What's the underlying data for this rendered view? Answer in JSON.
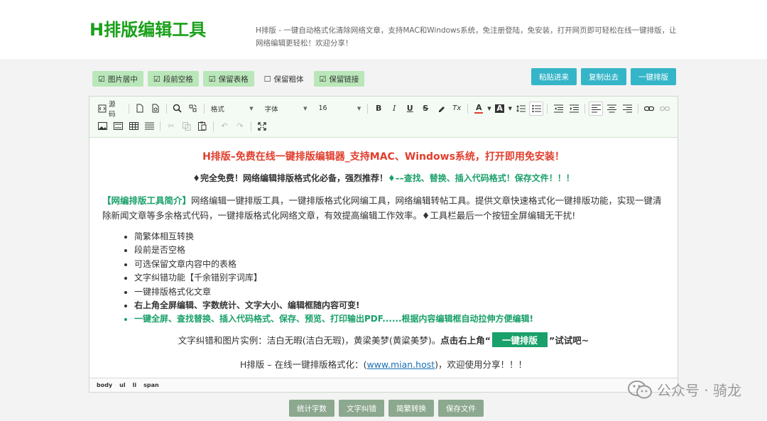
{
  "header": {
    "logo": "H排版编辑工具",
    "description": "H排版 - 一键自动格式化清除网络文章，支持MAC和Windows系统，免注册登陆，免安装，打开网页即可轻松在线一键排版，让网络编辑更轻松！欢迎分享！"
  },
  "options": [
    {
      "label": "图片居中",
      "checked": true,
      "mark": "☑"
    },
    {
      "label": "段前空格",
      "checked": true,
      "mark": "☑"
    },
    {
      "label": "保留表格",
      "checked": true,
      "mark": "☑"
    },
    {
      "label": "保留粗体",
      "checked": false,
      "mark": "☐"
    },
    {
      "label": "保留链接",
      "checked": true,
      "mark": "☑"
    }
  ],
  "actions": {
    "paste": "粘贴进来",
    "copy": "复制出去",
    "format": "一键排版"
  },
  "toolbar": {
    "source": "源码",
    "format_select": "格式",
    "font_select": "字体",
    "size_select": "16",
    "bold": "B",
    "italic": "I",
    "underline": "U",
    "strike": "S",
    "clear": "Tx",
    "font_color": "A",
    "bg_color": "A"
  },
  "content": {
    "title": "H排版–免费在线一键排版编辑器_支持MAC、Windows系统，打开即用免安装！",
    "subtitle_a": "♦完全免费！网络编辑排版格式化必备，强烈推荐！",
    "subtitle_b": "♦––查找、替换、插入代码格式！保存文件！！！",
    "intro_lead": "【网编排版工具简介】",
    "intro_text": "网络编辑一键排版工具，一键排版格式化网编工具，网络编辑转帖工具。提供文章快速格式化一键排版功能，实现一键清除新闻文章等多余格式代码，一键排版格式化网络文章，有效提高编辑工作效率。♦工具栏最后一个按钮全屏编辑无干扰!",
    "features": [
      "简繁体相互转换",
      "段前是否空格",
      "可选保留文章内容中的表格",
      "文字纠错功能【千余错别字词库】",
      "一键排版格式化文章",
      "右上角全屏编辑、字数统计、文字大小、编辑框随内容可变!",
      "一键全屏、查找替换、插入代码格式、保存、预览、打印输出PDF......根据内容编辑框自动拉伸方便编辑!"
    ],
    "example_text": "文字纠错和图片实例：洁白无暇(洁白无瑕)，黄梁美梦(黄粱美梦)。",
    "example_bold_a": "点击右上角“",
    "example_tag": "一键排版",
    "example_bold_b": "”试试吧~",
    "site_prefix": "H排版 – 在线一键排版格式化：(",
    "site_link": "www.mian.host",
    "site_suffix": ")，欢迎使用分享！！！"
  },
  "statusbar": {
    "path": [
      "body",
      "ul",
      "li",
      "span"
    ]
  },
  "bottom_buttons": {
    "count": "统计字数",
    "correct": "文字纠错",
    "convert": "简繁转换",
    "save": "保存文件"
  },
  "watermark": {
    "text": "公众号 · 骑龙"
  },
  "colors": {
    "logo": "#1aa01a",
    "title_red": "#e03e2d",
    "accent_green": "#1aa06a",
    "action_btn": "#35b5c8",
    "bottom_btn": "#8ca88e",
    "link": "#1a6fb5"
  }
}
